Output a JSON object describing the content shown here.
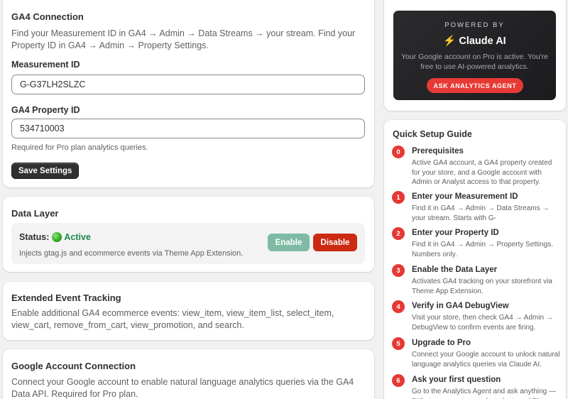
{
  "ga4": {
    "title": "GA4 Connection",
    "description": "Find your Measurement ID in GA4 → Admin → Data Streams → your stream. Find your Property ID in GA4 → Admin → Property Settings.",
    "measurement_label": "Measurement ID",
    "measurement_value": "G-G37LH2SLZC",
    "property_label": "GA4 Property ID",
    "property_value": "534710003",
    "property_help": "Required for Pro plan analytics queries.",
    "save_label": "Save Settings"
  },
  "data_layer": {
    "title": "Data Layer",
    "status_prefix": "Status:",
    "status_value": "Active",
    "status_color": "#1b8a4a",
    "description": "Injects gtag.js and ecommerce events via Theme App Extension.",
    "enable_label": "Enable",
    "disable_label": "Disable"
  },
  "extended": {
    "title": "Extended Event Tracking",
    "description": "Enable additional GA4 ecommerce events: view_item, view_item_list, select_item, view_cart, remove_from_cart, view_promotion, and search."
  },
  "google": {
    "title": "Google Account Connection",
    "description": "Connect your Google account to enable natural language analytics queries via the GA4 Data API. Required for Pro plan."
  },
  "powered": {
    "powered_by": "POWERED BY",
    "icon": "lightning-bolt-icon",
    "brand": "Claude AI",
    "description": "Your Google account on Pro is active. You're free to use AI-powered analytics.",
    "cta_label": "ASK ANALYTICS AGENT",
    "accent_color": "#e83a35"
  },
  "guide": {
    "title": "Quick Setup Guide",
    "steps": [
      {
        "num": "0",
        "title": "Prerequisites",
        "desc": "Active GA4 account, a GA4 property created for your store, and a Google account with Admin or Analyst access to that property."
      },
      {
        "num": "1",
        "title": "Enter your Measurement ID",
        "desc": "Find it in GA4 → Admin → Data Streams → your stream. Starts with G-"
      },
      {
        "num": "2",
        "title": "Enter your Property ID",
        "desc": "Find it in GA4 → Admin → Property Settings. Numbers only."
      },
      {
        "num": "3",
        "title": "Enable the Data Layer",
        "desc": "Activates GA4 tracking on your storefront via Theme App Extension."
      },
      {
        "num": "4",
        "title": "Verify in GA4 DebugView",
        "desc": "Visit your store, then check GA4 → Admin → DebugView to confirm events are firing."
      },
      {
        "num": "5",
        "title": "Upgrade to Pro",
        "desc": "Connect your Google account to unlock natural language analytics queries via Claude AI."
      },
      {
        "num": "6",
        "title": "Ask your first question",
        "desc": "Go to the Analytics Agent and ask anything — \"What were my top products last week?\""
      }
    ]
  }
}
